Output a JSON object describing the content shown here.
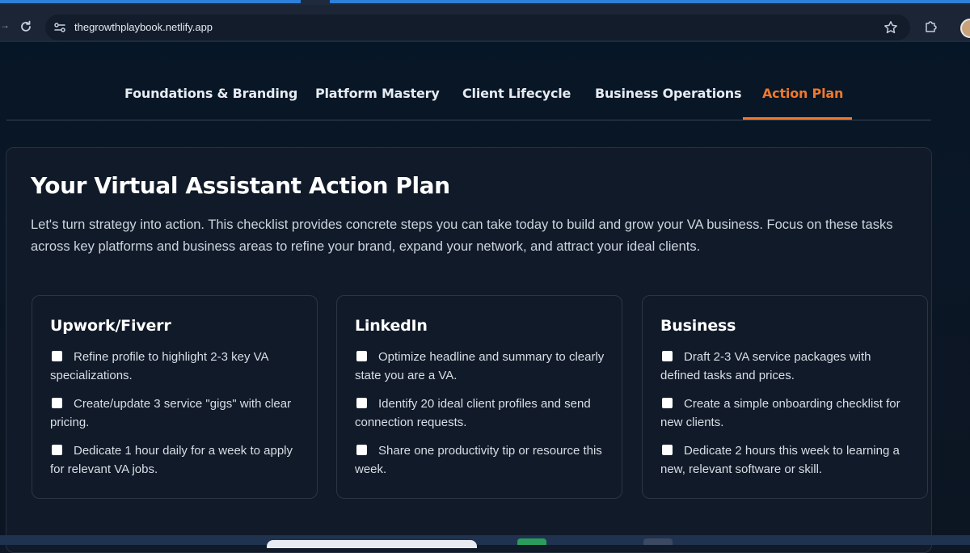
{
  "browser": {
    "url": "thegrowthplaybook.netlify.app"
  },
  "nav": {
    "items": [
      {
        "label": "Foundations & Branding",
        "active": false
      },
      {
        "label": "Platform Mastery",
        "active": false
      },
      {
        "label": "Client Lifecycle",
        "active": false
      },
      {
        "label": "Business Operations",
        "active": false
      },
      {
        "label": "Action Plan",
        "active": true
      }
    ],
    "accent_color": "#f0782a"
  },
  "main": {
    "title": "Your Virtual Assistant Action Plan",
    "intro": "Let's turn strategy into action. This checklist provides concrete steps you can take today to build and grow your VA business. Focus on these tasks across key platforms and business areas to refine your brand, expand your network, and attract your ideal clients.",
    "columns": [
      {
        "title": "Upwork/Fiverr",
        "tasks": [
          {
            "text": "Refine profile to highlight 2-3 key VA specializations.",
            "checked": false
          },
          {
            "text": "Create/update 3 service \"gigs\" with clear pricing.",
            "checked": false
          },
          {
            "text": "Dedicate 1 hour daily for a week to apply for relevant VA jobs.",
            "checked": false
          }
        ]
      },
      {
        "title": "LinkedIn",
        "tasks": [
          {
            "text": "Optimize headline and summary to clearly state you are a VA.",
            "checked": false
          },
          {
            "text": "Identify 20 ideal client profiles and send connection requests.",
            "checked": false
          },
          {
            "text": "Share one productivity tip or resource this week.",
            "checked": false
          }
        ]
      },
      {
        "title": "Business",
        "tasks": [
          {
            "text": "Draft 2-3 VA service packages with defined tasks and prices.",
            "checked": false
          },
          {
            "text": "Create a simple onboarding checklist for new clients.",
            "checked": false
          },
          {
            "text": "Dedicate 2 hours this week to learning a new, relevant software or skill.",
            "checked": false
          }
        ]
      }
    ]
  }
}
